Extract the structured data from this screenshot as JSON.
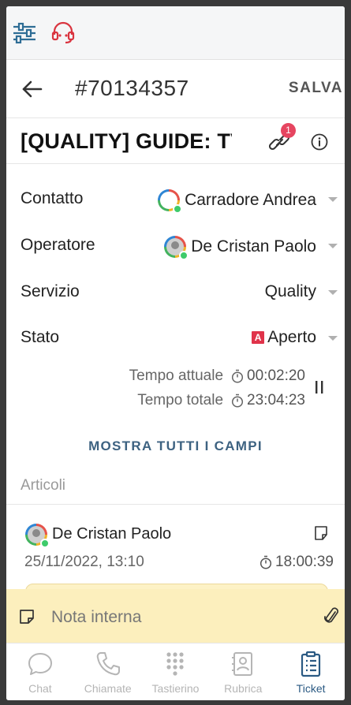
{
  "header": {
    "ticket_id": "#70134357",
    "save_label": "SALVA",
    "title": "[QUALITY] GUIDE: TVO",
    "link_count": "1"
  },
  "fields": [
    {
      "label": "Contatto",
      "value": "Carradore Andrea"
    },
    {
      "label": "Operatore",
      "value": "De Cristan Paolo"
    },
    {
      "label": "Servizio",
      "value": "Quality"
    },
    {
      "label": "Stato",
      "value": "Aperto",
      "status_icon": "A"
    }
  ],
  "timers": {
    "current_label": "Tempo attuale",
    "current_value": "00:02:20",
    "total_label": "Tempo totale",
    "total_value": "23:04:23"
  },
  "show_all_label": "MOSTRA TUTTI I CAMPI",
  "articles": {
    "heading": "Articoli",
    "items": [
      {
        "author": "De Cristan Paolo",
        "date": "25/11/2022, 13:10",
        "duration": "18:00:39"
      }
    ]
  },
  "note": {
    "placeholder": "Nota interna"
  },
  "nav": [
    {
      "label": "Chat",
      "icon": "chat-icon"
    },
    {
      "label": "Chiamate",
      "icon": "phone-icon"
    },
    {
      "label": "Tastierino",
      "icon": "keypad-icon"
    },
    {
      "label": "Rubrica",
      "icon": "contacts-icon"
    },
    {
      "label": "Ticket",
      "icon": "ticket-icon",
      "active": true
    }
  ],
  "colors": {
    "accent": "#2b5a83",
    "badge": "#e64560",
    "status_open": "#e0334a",
    "online": "#3ecb6b",
    "note_bg": "#fcefbd"
  }
}
